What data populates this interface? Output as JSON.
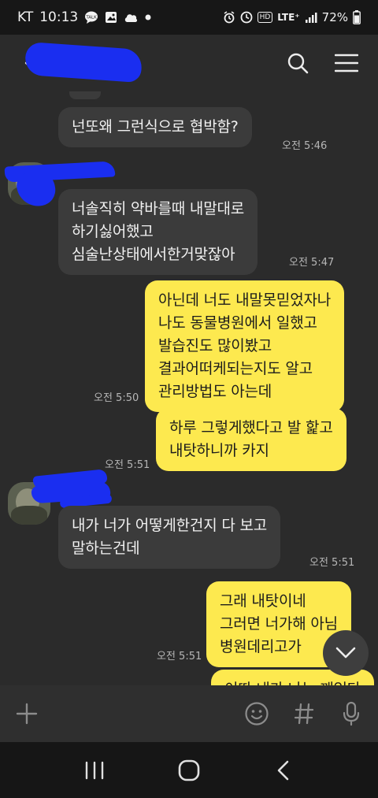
{
  "status_bar": {
    "carrier": "KT",
    "time": "10:13",
    "notif_icons": [
      "talk-icon",
      "gallery-icon",
      "cloud-icon",
      "dot-icon"
    ],
    "hd_label": "HD",
    "network_label": "LTE⁺",
    "battery": "72%"
  },
  "header": {
    "back_icon": "back-arrow-icon",
    "search_icon": "search-icon",
    "menu_icon": "menu-icon"
  },
  "messages": [
    {
      "type": "in",
      "text": "넌또왜 그런식으로 협박함?",
      "time": "오전 5:46"
    },
    {
      "type": "in",
      "text": "너솔직히 약바를때 내말대로\n하기싫어했고\n심술난상태에서한거맞잖아",
      "time": "오전 5:47"
    },
    {
      "type": "out",
      "text": "아닌데 너도 내말못믿었자나\n나도 동물병원에서 일했고\n발습진도 많이봤고\n결과어떠케되는지도 알고\n관리방법도 아는데",
      "time": "오전 5:50"
    },
    {
      "type": "out",
      "text": "하루 그렇게했다고 발 핥고\n내탓하니까 카지",
      "time": "오전 5:51"
    },
    {
      "type": "in",
      "text": "내가 너가 어떻게한건지 다 보고\n말하는건데",
      "time": "오전 5:51"
    },
    {
      "type": "out",
      "text": "그래 내탓이네\n그러면 너가해 아님\n병원데리고가",
      "time": "오전 5:51"
    },
    {
      "type": "out",
      "text": "이따 내가 나는 깨있다"
    }
  ],
  "input_bar": {
    "add_icon": "plus-icon",
    "emoji_icon": "emoji-icon",
    "hash_icon": "hash-icon",
    "mic_icon": "mic-icon"
  },
  "scroll_icon": "chevron-down-icon",
  "nav_bar": {
    "recents_icon": "recents-icon",
    "home_icon": "home-icon",
    "back_icon": "nav-back-icon"
  }
}
